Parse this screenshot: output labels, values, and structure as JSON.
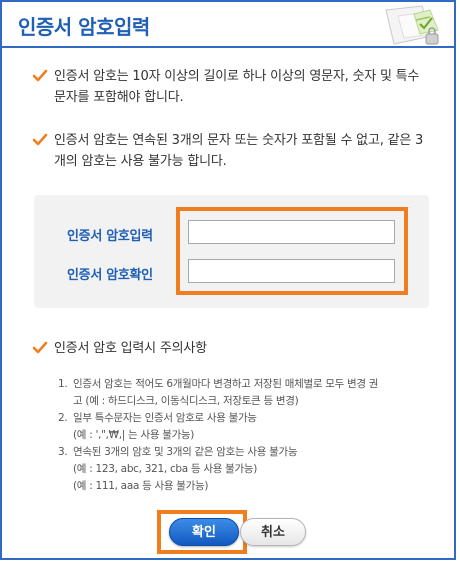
{
  "header": {
    "title": "인증서 암호입력"
  },
  "notices": [
    {
      "text": "인증서 암호는 10자 이상의 길이로 하나 이상의 영문자, 숫자 및 특수문자를 포함해야 합니다."
    },
    {
      "text": "인증서 암호는 연속된 3개의 문자 또는 숫자가 포함될 수 없고, 같은 3개의 암호는 사용 불가능 합니다."
    }
  ],
  "form": {
    "password_label": "인증서 암호입력",
    "password_value": "",
    "confirm_label": "인증서 암호확인",
    "confirm_value": ""
  },
  "caution": {
    "heading": "인증서 암호 입력시 주의사항",
    "items": [
      {
        "num": "1.",
        "line1": "인증서 암호는 적어도 6개월마다 변경하고 저장된 매체별로 모두 변경 권",
        "line2": "고 (예 : 하드디스크, 이동식디스크, 저장토큰 등 변경)"
      },
      {
        "num": "2.",
        "line1": "일부 특수문자는 인증서 암호로 사용 불가능",
        "line2": "(예 : ',\",₩,| 는 사용 불가능)"
      },
      {
        "num": "3.",
        "line1": "연속된 3개의 암호 및 3개의 같은 암호는 사용 불가능",
        "line2": "(예 : 123, abc, 321, cba 등 사용 불가능)",
        "line3": "(예 : 111, aaa 등 사용 불가능)"
      }
    ]
  },
  "buttons": {
    "ok_label": "확인",
    "cancel_label": "취소"
  },
  "colors": {
    "accent": "#1f5fb5",
    "border": "#2f6bc2",
    "highlight": "#f07e1f",
    "check": "#f07e1f"
  },
  "icons": {
    "check": "checkmark-icon",
    "header_decoration": "document-lock-icon"
  }
}
